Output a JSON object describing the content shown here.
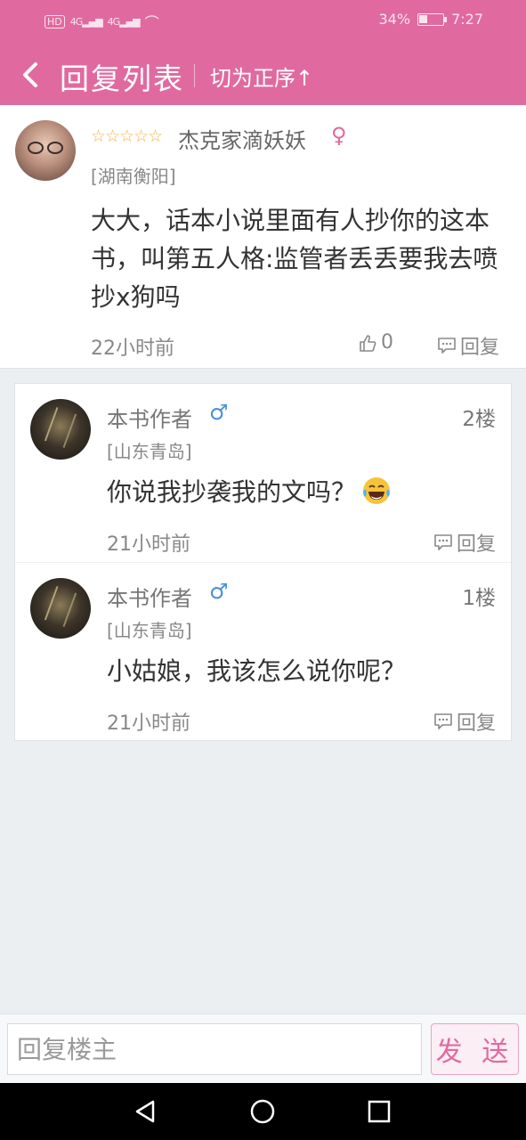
{
  "status_bar": {
    "hd": "HD",
    "signal1": "4G",
    "signal2": "4G",
    "battery_percent": "34%",
    "battery_level": 0.34,
    "time": "7:27"
  },
  "header": {
    "title": "回复列表",
    "order_toggle": "切为正序↑"
  },
  "main_comment": {
    "stars": "☆☆☆☆☆",
    "username": "杰克家滴妖妖",
    "gender_icon": "female-icon",
    "location": "[湖南衡阳]",
    "content": "大大，话本小说里面有人抄你的这本书，叫第五人格:监管者丢丢要我去喷抄x狗吗",
    "time": "22小时前",
    "likes": "0",
    "reply_label": "回复"
  },
  "replies": [
    {
      "username": "本书作者",
      "gender_icon": "male-icon",
      "floor": "2楼",
      "location": "[山东青岛]",
      "content": "你说我抄袭我的文吗？",
      "emoji": "tears-of-joy-emoji",
      "time": "21小时前",
      "reply_label": "回复"
    },
    {
      "username": "本书作者",
      "gender_icon": "male-icon",
      "floor": "1楼",
      "location": "[山东青岛]",
      "content": "小姑娘，我该怎么说你呢？",
      "time": "21小时前",
      "reply_label": "回复"
    }
  ],
  "input_bar": {
    "placeholder": "回复楼主",
    "send_label": "发 送"
  },
  "colors": {
    "brand": "#e06aa0",
    "male": "#4a90d9",
    "star": "#f2b44a"
  }
}
